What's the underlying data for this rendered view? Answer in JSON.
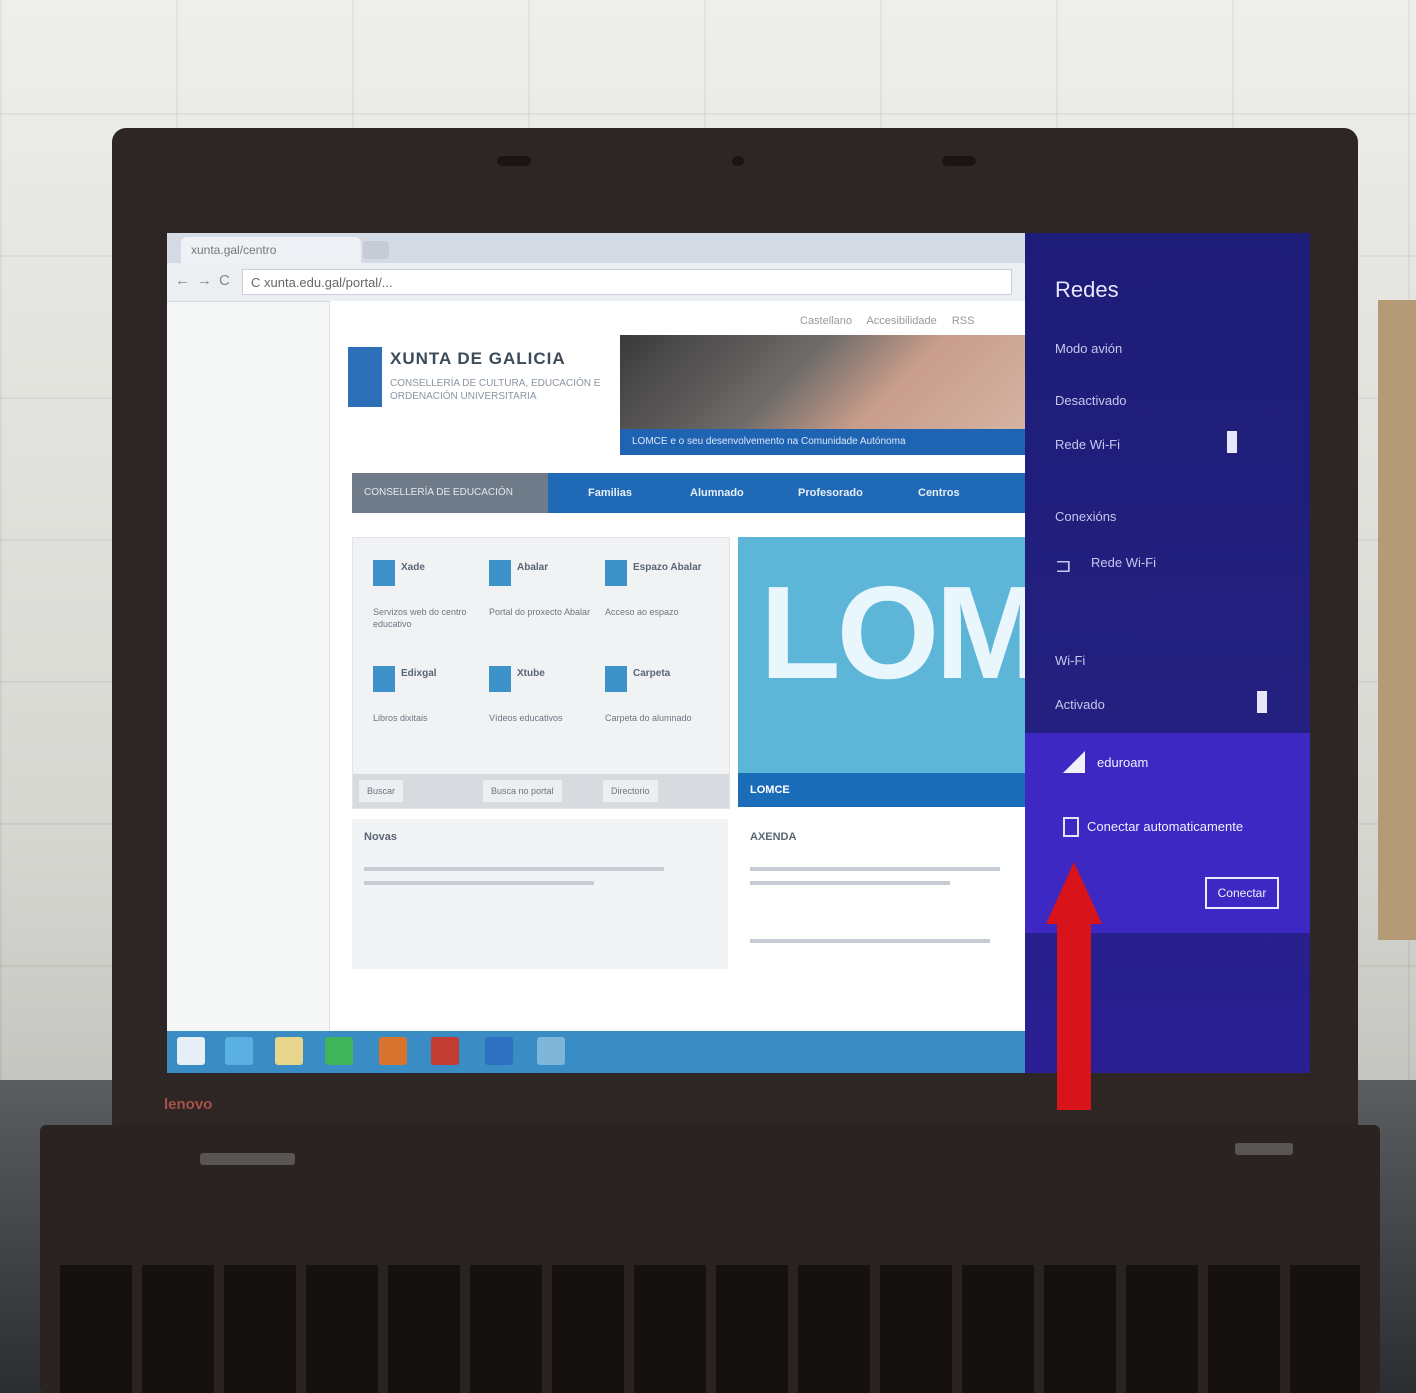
{
  "browser": {
    "tab_title": "xunta.gal/centro",
    "address": "C xunta.edu.gal/portal/...",
    "nav_back": "←",
    "nav_forward": "→",
    "nav_reload": "C"
  },
  "page": {
    "top_links": [
      "Castellano",
      "Accesibilidade",
      "RSS"
    ],
    "site_title": "XUNTA DE GALICIA",
    "site_subtitle": "CONSELLERÍA DE CULTURA, EDUCACIÓN E ORDENACIÓN UNIVERSITARIA",
    "banner_caption": "LOMCE e o seu desenvolvemento na Comunidade Autónoma",
    "nav": [
      "CONSELLERÍA DE EDUCACIÓN",
      "Familias",
      "Alumnado",
      "Profesorado",
      "Centros"
    ],
    "services": [
      {
        "title": "Xade",
        "desc": "Servizos web do centro educativo"
      },
      {
        "title": "Abalar",
        "desc": "Portal do proxecto Abalar"
      },
      {
        "title": "Espazo Abalar",
        "desc": "Acceso ao espazo"
      },
      {
        "title": "Edixgal",
        "desc": "Libros dixitais"
      },
      {
        "title": "Xtube",
        "desc": "Vídeos educativos"
      },
      {
        "title": "Carpeta",
        "desc": "Carpeta do alumnado"
      }
    ],
    "panel_buttons": [
      "Buscar",
      "Busca no portal",
      "Directorio"
    ],
    "lomce_text": "LOMC",
    "lomce_caption": "LOMCE",
    "news_left_heading": "Novas",
    "news_right_heading": "AXENDA"
  },
  "taskbar": {
    "icons": [
      "windows-icon",
      "ie-icon",
      "explorer-icon",
      "store-icon",
      "app-icon",
      "app-icon-2",
      "app-icon-3",
      "app-icon-4"
    ]
  },
  "charm": {
    "title": "Redes",
    "airplane_label": "Modo avión",
    "airplane_state": "Desactivado",
    "connections_heading": "Conexións",
    "network_name": "Rede Wi-Fi",
    "wifi_heading": "Wi-Fi",
    "wifi_state": "Activado",
    "network_ssid": "eduroam",
    "auto_connect_label": "Conectar automaticamente",
    "connect_button": "Conectar"
  },
  "device": {
    "brand": "lenovo"
  },
  "colors": {
    "charm_bg": "#1d1c78",
    "charm_highlight": "#3e28c4",
    "arrow": "#d8131a",
    "taskbar": "#3a8cc5"
  }
}
